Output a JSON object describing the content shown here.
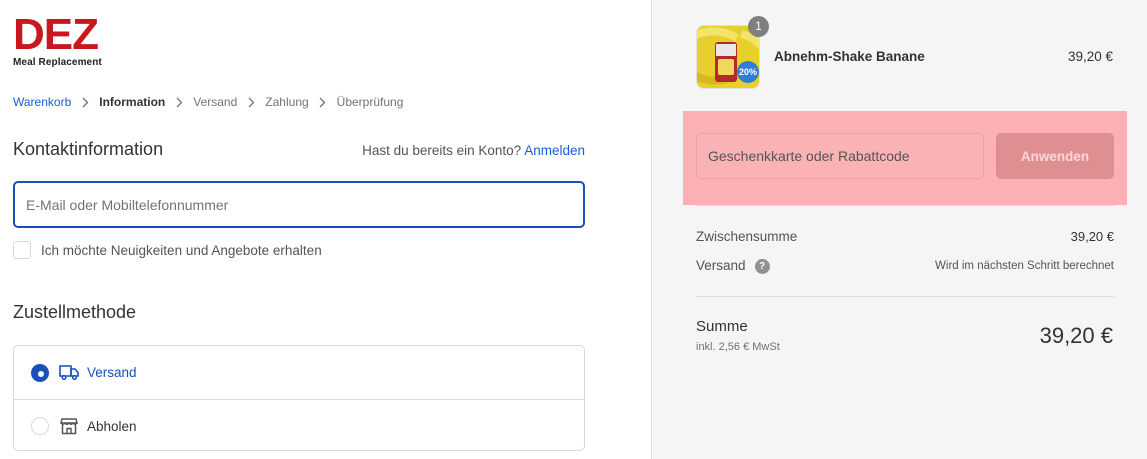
{
  "logo": {
    "brand": "DEZ",
    "subtitle": "Meal Replacement"
  },
  "breadcrumb": {
    "items": [
      "Warenkorb",
      "Information",
      "Versand",
      "Zahlung",
      "Überprüfung"
    ]
  },
  "contact": {
    "title": "Kontaktinformation",
    "login_prompt": "Hast du bereits ein Konto?",
    "login_link": "Anmelden",
    "email_placeholder": "E-Mail oder Mobiltelefonnummer",
    "newsletter_label": "Ich möchte Neuigkeiten und Angebote erhalten"
  },
  "delivery": {
    "title": "Zustellmethode",
    "options": [
      {
        "label": "Versand",
        "selected": true,
        "icon": "truck-icon"
      },
      {
        "label": "Abholen",
        "selected": false,
        "icon": "store-icon"
      }
    ]
  },
  "cart": {
    "product": {
      "name": "Abnehm-Shake Banane",
      "price": "39,20 €",
      "quantity": "1",
      "badge_text": "20%"
    },
    "discount": {
      "placeholder": "Geschenkkarte oder Rabattcode",
      "button": "Anwenden"
    },
    "subtotal_label": "Zwischensumme",
    "subtotal_value": "39,20 €",
    "shipping_label": "Versand",
    "shipping_value": "Wird im nächsten Schritt berechnet",
    "total_label": "Summe",
    "tax_note": "inkl. 2,56 € MwSt",
    "total_value": "39,20 €"
  },
  "colors": {
    "brand_red": "#c8171e",
    "link_blue": "#1a5ed4",
    "selected_blue": "#1a4fba",
    "highlight_pink": "#fdb0b3"
  }
}
